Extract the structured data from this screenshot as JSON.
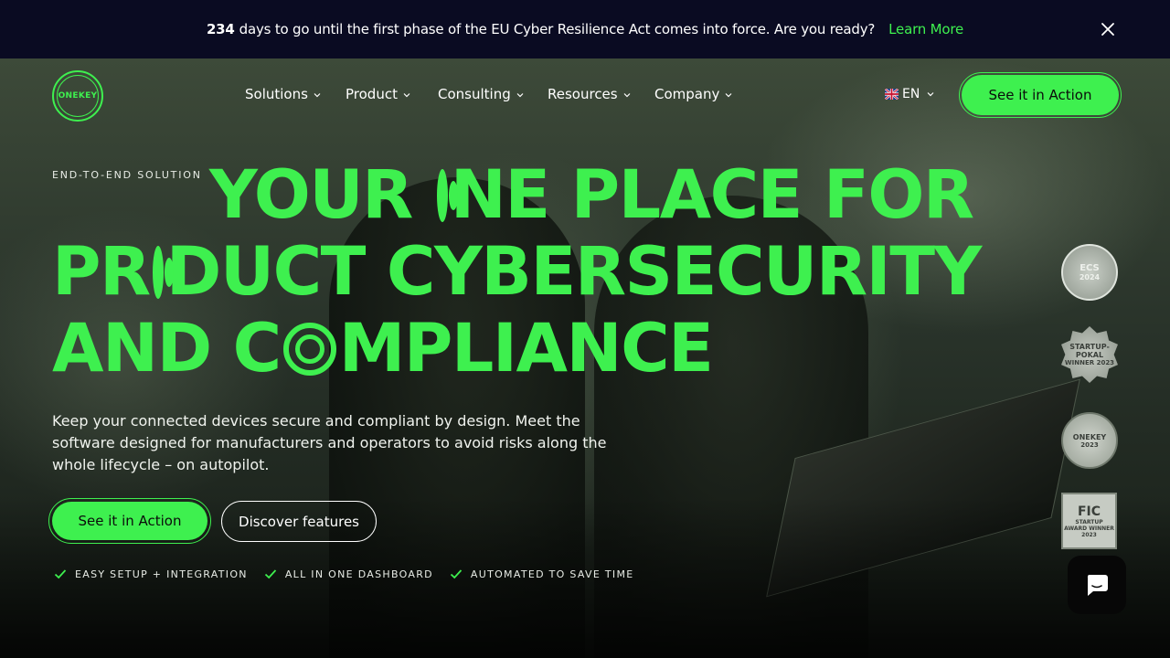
{
  "announcement": {
    "days": "234",
    "message": "days to go until the first phase of the EU Cyber Resilience Act comes into force. Are you ready?",
    "link": "Learn More",
    "close_icon": "close-icon"
  },
  "nav": {
    "logo_text": "ONEKEY",
    "menu": [
      {
        "label": "Solutions"
      },
      {
        "label": "Product"
      },
      {
        "label": "Consulting"
      },
      {
        "label": "Resources"
      },
      {
        "label": "Company"
      }
    ],
    "language": "EN",
    "cta": "See it in Action"
  },
  "hero": {
    "eyebrow": "END-TO-END SOLUTION",
    "headline": {
      "line1_a": "YOUR ",
      "line1_b": "NE PLACE FOR",
      "line2_a": "PR",
      "line2_b": "DUCT CYBERSECURITY",
      "line3_a": "AND C",
      "line3_b": "MPLIANCE"
    },
    "subtext": "Keep your connected devices secure and compliant by design. Meet the software designed for manufacturers and operators to avoid risks along the whole lifecycle – on autopilot.",
    "primary_button": "See it in Action",
    "secondary_button": "Discover features",
    "features": [
      "EASY SETUP + INTEGRATION",
      "ALL IN ONE DASHBOARD",
      "AUTOMATED TO SAVE TIME"
    ]
  },
  "badges": [
    {
      "title": "ECS",
      "subtitle": "2024"
    },
    {
      "title": "STARTUP-POKAL",
      "subtitle": "WINNER 2023"
    },
    {
      "title": "ONEKEY",
      "subtitle": "2023"
    },
    {
      "title": "FIC",
      "subtitle": "STARTUP AWARD WINNER 2023"
    }
  ],
  "colors": {
    "accent": "#3ef04f",
    "topbar": "#0a0b22"
  }
}
